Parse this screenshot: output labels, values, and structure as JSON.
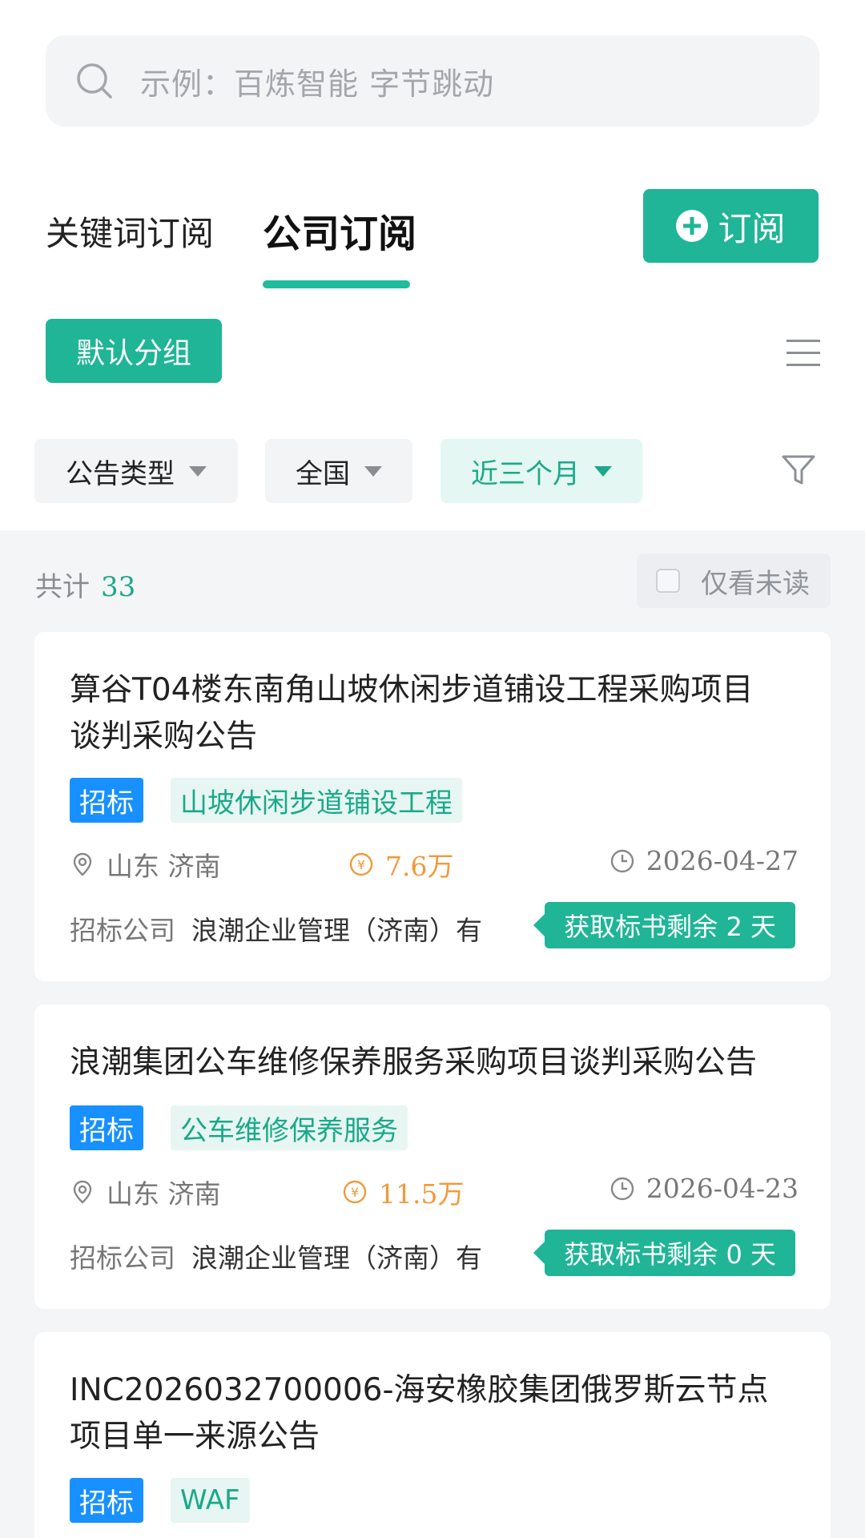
{
  "search": {
    "placeholder": "示例：百炼智能 字节跳动"
  },
  "tabs": [
    {
      "label": "关键词订阅"
    },
    {
      "label": "公司订阅"
    }
  ],
  "subscribe_button": {
    "label": "订阅"
  },
  "group": {
    "label": "默认分组"
  },
  "filters": [
    {
      "label": "公告类型"
    },
    {
      "label": "全国"
    },
    {
      "label": "近三个月"
    }
  ],
  "summary": {
    "count_label": "共计",
    "count": "33",
    "unread_label": "仅看未读"
  },
  "colors": {
    "accent": "#1fb596",
    "tag_blue": "#1890ff",
    "amount": "#f09a3a"
  },
  "cards": [
    {
      "title": "算谷T04楼东南角山坡休闲步道铺设工程采购项目谈判采购公告",
      "type": "招标",
      "keyword": "山坡休闲步道铺设工程",
      "location": "山东 济南",
      "amount": "7.6万",
      "date": "2026-04-27",
      "company_label": "招标公司",
      "company": "浪潮企业管理（济南）有",
      "deadline": "获取标书剩余 2 天"
    },
    {
      "title": "浪潮集团公车维修保养服务采购项目谈判采购公告",
      "type": "招标",
      "keyword": "公车维修保养服务",
      "location": "山东 济南",
      "amount": "11.5万",
      "date": "2026-04-23",
      "company_label": "招标公司",
      "company": "浪潮企业管理（济南）有",
      "deadline": "获取标书剩余 0 天"
    },
    {
      "title": "INC2026032700006-海安橡胶集团俄罗斯云节点项目单一来源公告",
      "type": "招标",
      "keyword": "WAF"
    }
  ]
}
